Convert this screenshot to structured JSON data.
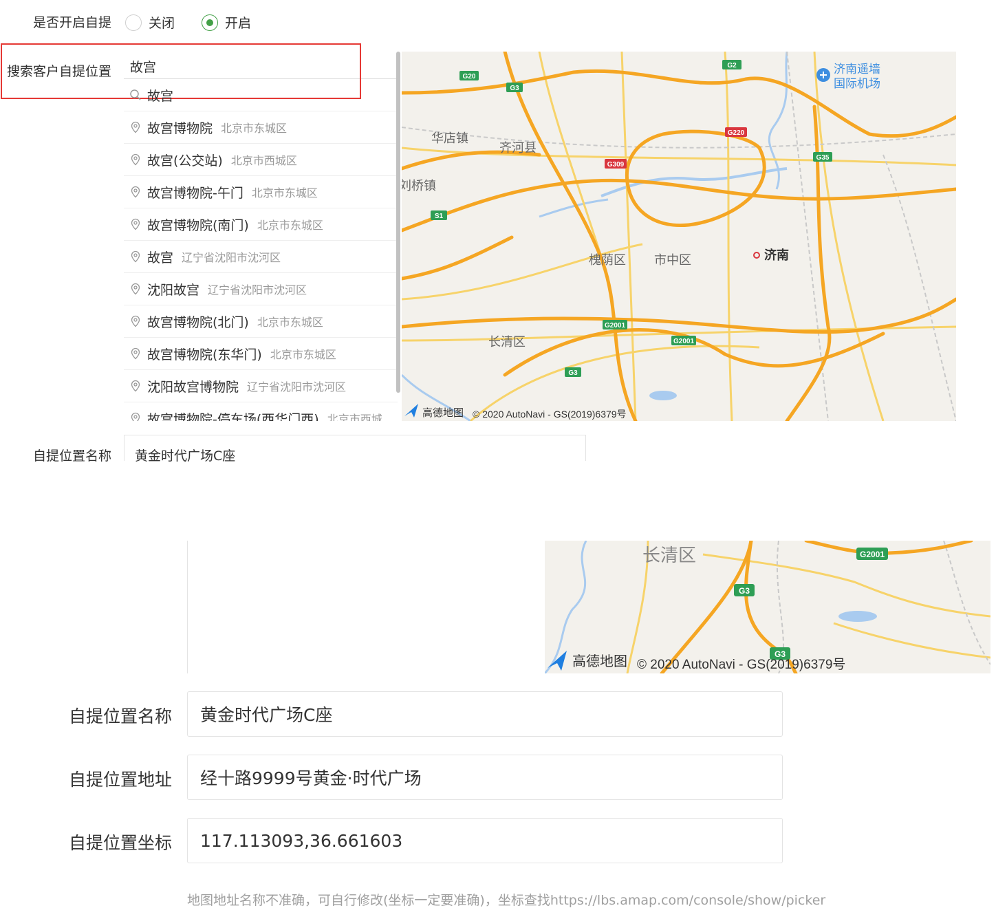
{
  "top": {
    "enable_label": "是否开启自提",
    "radio_off": "关闭",
    "radio_on": "开启",
    "search_label": "搜索客户自提位置",
    "search_value": "故宫",
    "suggestions": [
      {
        "name": "故宫",
        "district": ""
      },
      {
        "name": "故宫博物院",
        "district": "北京市东城区"
      },
      {
        "name": "故宫(公交站)",
        "district": "北京市西城区"
      },
      {
        "name": "故宫博物院-午门",
        "district": "北京市东城区"
      },
      {
        "name": "故宫博物院(南门)",
        "district": "北京市东城区"
      },
      {
        "name": "故宫",
        "district": "辽宁省沈阳市沈河区"
      },
      {
        "name": "沈阳故宫",
        "district": "辽宁省沈阳市沈河区"
      },
      {
        "name": "故宫博物院(北门)",
        "district": "北京市东城区"
      },
      {
        "name": "故宫博物院(东华门)",
        "district": "北京市东城区"
      },
      {
        "name": "沈阳故宫博物院",
        "district": "辽宁省沈阳市沈河区"
      },
      {
        "name": "故宫博物院-停车场(西华门西)",
        "district": "北京市西城"
      }
    ],
    "name_label": "自提位置名称",
    "name_value": "黄金时代广场C座"
  },
  "map": {
    "places": [
      "济南遥墙",
      "国际机场",
      "华店镇",
      "齐河县",
      "刘桥镇",
      "槐荫区",
      "市中区",
      "济南",
      "长清区"
    ],
    "road_badges": [
      "G20",
      "G3",
      "G2",
      "G220",
      "G309",
      "G35",
      "S1",
      "G2001"
    ],
    "logo": "高德地图",
    "copyright": "© 2020 AutoNavi - GS(2019)6379号"
  },
  "bottom": {
    "map_place": "长清区",
    "badge_g3": "G3",
    "badge_g2001": "G2001",
    "name_label": "自提位置名称",
    "name_value": "黄金时代广场C座",
    "address_label": "自提位置地址",
    "address_value": "经十路9999号黄金·时代广场",
    "coord_label": "自提位置坐标",
    "coord_value": "117.113093,36.661603",
    "hint": "地图地址名称不准确，可自行修改(坐标一定要准确)，坐标查找https://lbs.amap.com/console/show/picker"
  },
  "colors": {
    "accent_green": "#43a047",
    "highlight_red": "#e53935",
    "road_orange": "#f5a623",
    "road_yellow": "#f7d36a",
    "water": "#a9cbef"
  }
}
